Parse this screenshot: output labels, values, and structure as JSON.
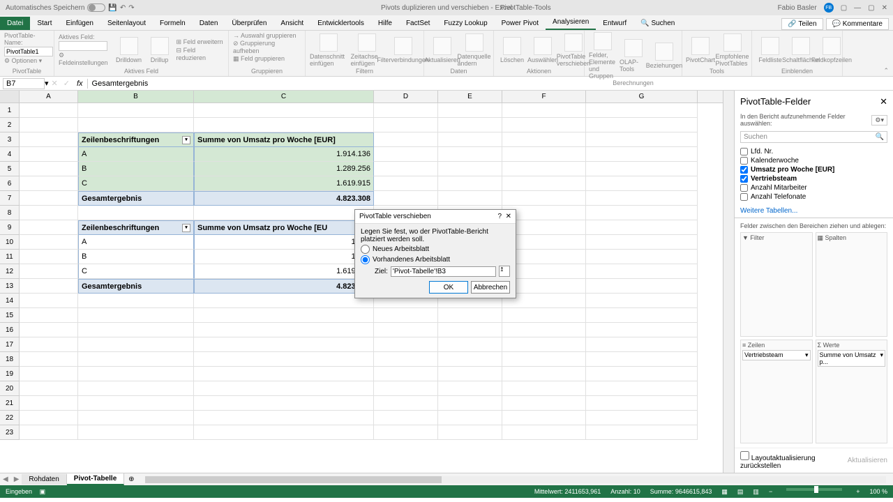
{
  "titlebar": {
    "autosave": "Automatisches Speichern",
    "doc_title": "Pivots duplizieren und verschieben - Excel",
    "tool_tab": "PivotTable-Tools",
    "user": "Fabio Basler",
    "user_initials": "FB"
  },
  "menu": {
    "file": "Datei",
    "items": [
      "Start",
      "Einfügen",
      "Seitenlayout",
      "Formeln",
      "Daten",
      "Überprüfen",
      "Ansicht",
      "Entwicklertools",
      "Hilfe",
      "FactSet",
      "Fuzzy Lookup",
      "Power Pivot",
      "Analysieren",
      "Entwurf"
    ],
    "search_placeholder": "Suchen",
    "share": "Teilen",
    "comments": "Kommentare"
  },
  "ribbon": {
    "pt_name_lbl": "PivotTable-Name:",
    "pt_name_val": "PivotTable1",
    "options": "Optionen",
    "active_field_lbl": "Aktives Feld:",
    "field_settings": "Feldeinstellungen",
    "drilldown": "Drilldown",
    "drillup": "Drillup",
    "expand": "Feld erweitern",
    "collapse": "Feld reduzieren",
    "group_sel": "Auswahl gruppieren",
    "ungroup": "Gruppierung aufheben",
    "group_field": "Feld gruppieren",
    "slicer": "Datenschnitt einfügen",
    "timeline": "Zeitachse einfügen",
    "filterconn": "Filterverbindungen",
    "refresh": "Aktualisieren",
    "changesrc": "Datenquelle ändern",
    "clear": "Löschen",
    "select": "Auswählen",
    "move": "PivotTable verschieben",
    "calc": "Felder, Elemente und Gruppen",
    "olap": "OLAP-Tools",
    "relations": "Beziehungen",
    "chart": "PivotChart",
    "recommend": "Empfohlene PivotTables",
    "fieldlist": "Feldliste",
    "buttons": "Schaltflächen",
    "headers": "Feldkopfzeilen",
    "groups": {
      "pivottable": "PivotTable",
      "activefield": "Aktives Feld",
      "group": "Gruppieren",
      "filter": "Filtern",
      "data": "Daten",
      "actions": "Aktionen",
      "calculations": "Berechnungen",
      "tools": "Tools",
      "show": "Einblenden"
    }
  },
  "fx": {
    "cellref": "B7",
    "fx": "fx",
    "formula": "Gesamtergebnis"
  },
  "cols": [
    "A",
    "B",
    "C",
    "D",
    "E",
    "F",
    "G"
  ],
  "rownums": [
    "1",
    "2",
    "3",
    "4",
    "5",
    "6",
    "7",
    "8",
    "9",
    "10",
    "11",
    "12",
    "13",
    "14",
    "15",
    "16",
    "17",
    "18",
    "19",
    "20",
    "21",
    "22",
    "23"
  ],
  "pivot": {
    "hdr_rows": "Zeilenbeschriftungen",
    "hdr_vals": "Summe von Umsatz pro Woche [EUR]",
    "rows": [
      {
        "label": "A",
        "val": "1.914.136"
      },
      {
        "label": "B",
        "val": "1.289.256"
      },
      {
        "label": "C",
        "val": "1.619.915"
      }
    ],
    "total_lbl": "Gesamtergebnis",
    "total_val": "4.823.308"
  },
  "pivot2": {
    "hdr_rows": "Zeilenbeschriftungen",
    "hdr_vals": "Summe von Umsatz pro Woche [EU",
    "rows": [
      {
        "label": "A",
        "val": "1.914"
      },
      {
        "label": "B",
        "val": "1.289"
      },
      {
        "label": "C",
        "val": "1.619.915"
      }
    ],
    "total_lbl": "Gesamtergebnis",
    "total_val": "4.823.308"
  },
  "dialog": {
    "title": "PivotTable verschieben",
    "instruction": "Legen Sie fest, wo der PivotTable-Bericht platziert werden soll.",
    "opt_new": "Neues Arbeitsblatt",
    "opt_exist": "Vorhandenes Arbeitsblatt",
    "target_lbl": "Ziel:",
    "target_val": "'Pivot-Tabelle'!B3",
    "ok": "OK",
    "cancel": "Abbrechen"
  },
  "sidepane": {
    "title": "PivotTable-Felder",
    "subtitle": "In den Bericht aufzunehmende Felder auswählen:",
    "search": "Suchen",
    "fields": [
      {
        "name": "Lfd. Nr.",
        "checked": false
      },
      {
        "name": "Kalenderwoche",
        "checked": false
      },
      {
        "name": "Umsatz pro Woche [EUR]",
        "checked": true
      },
      {
        "name": "Vertriebsteam",
        "checked": true
      },
      {
        "name": "Anzahl Mitarbeiter",
        "checked": false
      },
      {
        "name": "Anzahl Telefonate",
        "checked": false
      }
    ],
    "more_tables": "Weitere Tabellen...",
    "drag_lbl": "Felder zwischen den Bereichen ziehen und ablegen:",
    "filter": "Filter",
    "columns": "Spalten",
    "rows": "Zeilen",
    "values": "Werte",
    "rows_item": "Vertriebsteam",
    "values_item": "Summe von Umsatz p...",
    "defer": "Layoutaktualisierung zurückstellen",
    "update": "Aktualisieren"
  },
  "sheettabs": {
    "tabs": [
      "Rohdaten",
      "Pivot-Tabelle"
    ],
    "active": 1
  },
  "status": {
    "mode": "Eingeben",
    "avg_lbl": "Mittelwert:",
    "avg": "2411653,961",
    "count_lbl": "Anzahl:",
    "count": "10",
    "sum_lbl": "Summe:",
    "sum": "9646615,843",
    "zoom": "100 %"
  }
}
